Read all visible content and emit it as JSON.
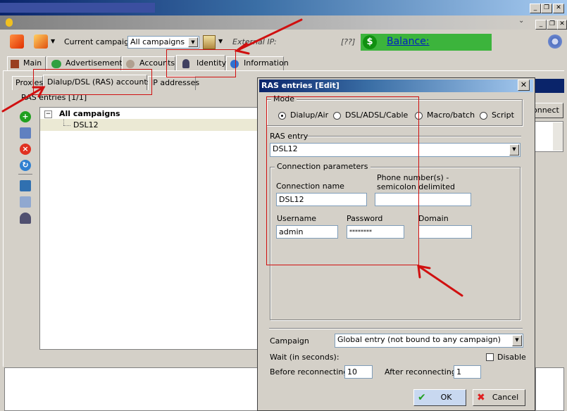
{
  "window": {
    "minimize_glyph": "_",
    "restore_glyph": "❐",
    "close_glyph": "✕",
    "inner_collapse_glyph": "⌄"
  },
  "toolbar": {
    "campaign_label": "Current campaign",
    "campaign_value": "All campaigns",
    "external_ip_label": "External IP:",
    "external_ip_value": "[??]",
    "balance_label": "Balance:",
    "balance_symbol": "$"
  },
  "tabs": [
    "Main",
    "Advertisements",
    "Accounts",
    "Identity",
    "Information"
  ],
  "subtabs": [
    "Proxies",
    "Dialup/DSL (RAS) accounts",
    "IP addresses"
  ],
  "ras_panel": {
    "header": "RAS entries [1/1]",
    "tree_root": "All campaigns",
    "tree_child": "DSL12",
    "tree_toggle": "−"
  },
  "right_panel": {
    "connect_label": "onnect"
  },
  "dialog": {
    "title": "RAS entries [Edit]",
    "close": "✕",
    "mode_legend": "Mode",
    "modes": [
      "Dialup/Air",
      "DSL/ADSL/Cable",
      "Macro/batch",
      "Script"
    ],
    "selected_mode": "Dialup/Air",
    "ras_entry_legend": "RAS entry",
    "ras_entry_value": "DSL12",
    "conn_params_legend": "Connection parameters",
    "connection_name_label": "Connection name",
    "connection_name_value": "DSL12",
    "phone_label_1": "Phone number(s) -",
    "phone_label_2": "semicolon delimited",
    "phone_value": "",
    "username_label": "Username",
    "username_value": "admin",
    "password_label": "Password",
    "password_value": "********",
    "domain_label": "Domain",
    "domain_value": "",
    "campaign_label": "Campaign",
    "campaign_value": "Global entry (not bound to any campaign)",
    "wait_label": "Wait (in seconds):",
    "disable_label": "Disable",
    "before_label": "Before reconnecting",
    "before_value": "10",
    "after_label": "After reconnecting",
    "after_value": "1",
    "ok_label": "OK",
    "cancel_label": "Cancel"
  },
  "colors": {
    "annotation_red": "#d01010",
    "balance_green": "#3cb43c",
    "title_blue": "#0a246a"
  }
}
